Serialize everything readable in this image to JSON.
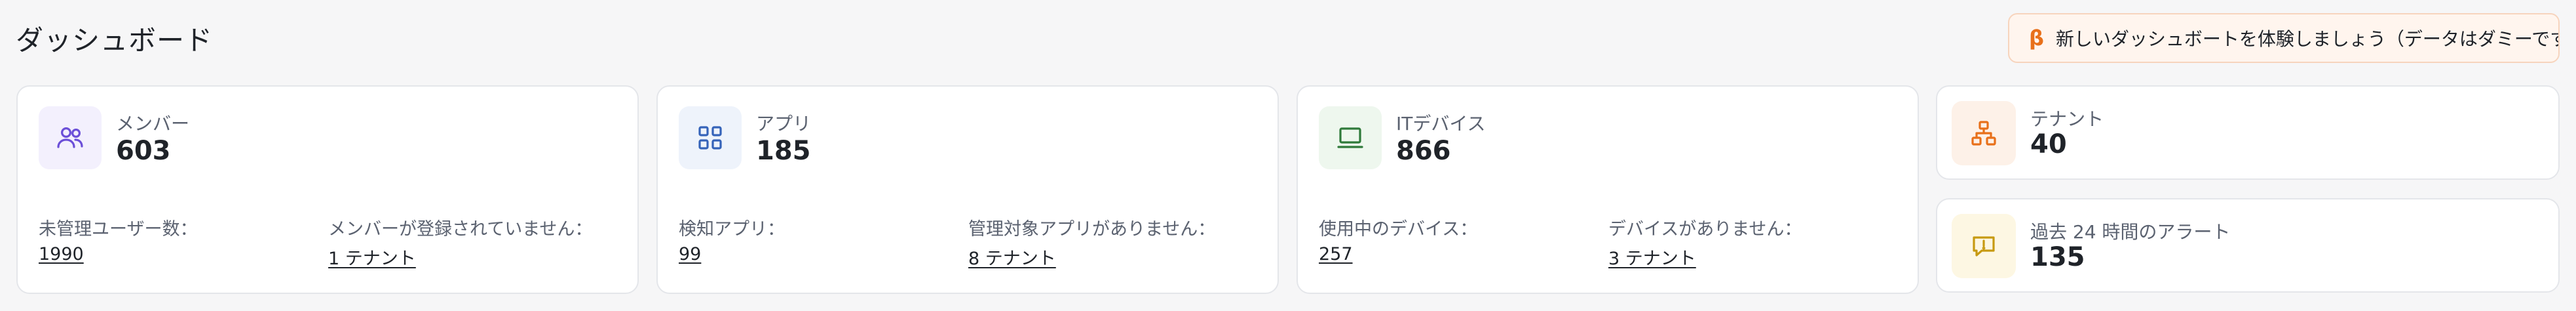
{
  "header": {
    "title": "ダッシュボード",
    "beta_icon": "β",
    "beta_text": "新しいダッシュボートを体験しましょう（データはダミーです）"
  },
  "cards": {
    "members": {
      "icon": "users-icon",
      "label": "メンバー",
      "value": "603",
      "stat1_label": "未管理ユーザー数：",
      "stat1_value": "1990",
      "stat2_label": "メンバーが登録されていません：",
      "stat2_value": "1 テナント"
    },
    "apps": {
      "icon": "grid-icon",
      "label": "アプリ",
      "value": "185",
      "stat1_label": "検知アプリ：",
      "stat1_value": "99",
      "stat2_label": "管理対象アプリがありません：",
      "stat2_value": "8 テナント"
    },
    "devices": {
      "icon": "laptop-icon",
      "label": "ITデバイス",
      "value": "866",
      "stat1_label": "使用中のデバイス：",
      "stat1_value": "257",
      "stat2_label": "デバイスがありません：",
      "stat2_value": "3 テナント"
    },
    "tenants": {
      "icon": "org-chart-icon",
      "label": "テナント",
      "value": "40"
    },
    "alerts": {
      "icon": "alert-message-icon",
      "label": "過去 24 時間のアラート",
      "value": "135"
    }
  },
  "colors": {
    "members_icon": "#6b4fd8",
    "members_bg": "#f3f0fd",
    "apps_icon": "#3563b9",
    "apps_bg": "#eef3fb",
    "devices_icon": "#2f7a3a",
    "devices_bg": "#eef7ee",
    "tenants_icon": "#e8701a",
    "tenants_bg": "#fdf1e8",
    "alerts_icon": "#c79a12",
    "alerts_bg": "#fdf7e3",
    "beta_accent": "#e8701a"
  }
}
